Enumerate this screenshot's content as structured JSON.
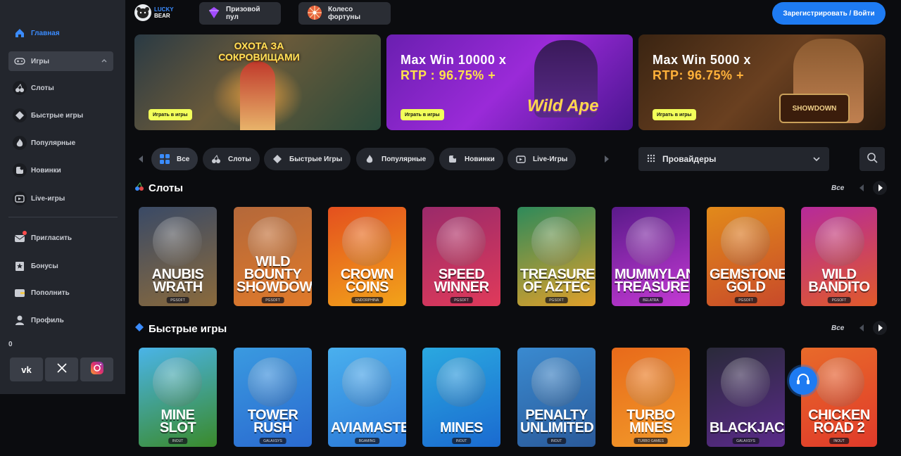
{
  "sidebar": {
    "items": [
      {
        "label": "Главная"
      },
      {
        "label": "Игры"
      },
      {
        "label": "Слоты"
      },
      {
        "label": "Быстрые игры"
      },
      {
        "label": "Популярные"
      },
      {
        "label": "Новинки"
      },
      {
        "label": "Live-игры"
      },
      {
        "label": "Пригласить"
      },
      {
        "label": "Бонусы"
      },
      {
        "label": "Пополнить"
      },
      {
        "label": "Профиль"
      }
    ],
    "balance": "0",
    "socials": [
      "vk-icon",
      "x-icon",
      "instagram-icon"
    ]
  },
  "header": {
    "logo_top": "LUCKY",
    "logo_bottom": "BEAR",
    "prize_pool": "Призовой пул",
    "wheel": "Колесо фортуны",
    "register": "Зарегистрировать / Войти"
  },
  "banners": [
    {
      "title": "ОХОТА ЗА СОКРОВИЩАМИ",
      "cta": "Играть в игры"
    },
    {
      "line1": "Max Win 10000 x",
      "line2": "RTP : 96.75% +",
      "logo": "Wild Ape",
      "cta": "Играть в игры"
    },
    {
      "line1": "Max Win 5000 x",
      "line2": "RTP: 96.75% +",
      "logo": "SHOWDOWN",
      "cta": "Играть в игры"
    }
  ],
  "filters": {
    "chips": [
      {
        "label": "Все"
      },
      {
        "label": "Слоты"
      },
      {
        "label": "Быстрые Игры"
      },
      {
        "label": "Популярные"
      },
      {
        "label": "Новинки"
      },
      {
        "label": "Live-Игры"
      }
    ],
    "providers": "Провайдеры"
  },
  "sections": [
    {
      "title": "Слоты",
      "all": "Все",
      "games": [
        {
          "name": "ANUBIS WRATH",
          "provider": "PGSOFT",
          "c1": "#3a4a66",
          "c2": "#8a6a3c"
        },
        {
          "name": "WILD BOUNTY SHOWDOWN",
          "provider": "PGSOFT",
          "c1": "#b4683a",
          "c2": "#e07a2a"
        },
        {
          "name": "CROWN COINS",
          "provider": "ENDORPHINA",
          "c1": "#e4501e",
          "c2": "#f2a31a"
        },
        {
          "name": "SPEED WINNER",
          "provider": "PGSOFT",
          "c1": "#9a2a6a",
          "c2": "#e03a5a"
        },
        {
          "name": "TREASURES OF AZTEC",
          "provider": "PGSOFT",
          "c1": "#2e8a5a",
          "c2": "#e0a02a"
        },
        {
          "name": "MUMMYLAND TREASURES",
          "provider": "BELATRA",
          "c1": "#5a1a8a",
          "c2": "#c43ad4"
        },
        {
          "name": "GEMSTONES GOLD",
          "provider": "PGSOFT",
          "c1": "#e28a1a",
          "c2": "#c84a2a"
        },
        {
          "name": "WILD BANDITO",
          "provider": "PGSOFT",
          "c1": "#b62a9a",
          "c2": "#e05a2a"
        }
      ]
    },
    {
      "title": "Быстрые игры",
      "all": "Все",
      "games": [
        {
          "name": "MINE SLOT",
          "provider": "INOUT",
          "c1": "#4ab4e8",
          "c2": "#3a8a2a"
        },
        {
          "name": "TOWER RUSH",
          "provider": "GALAXSYS",
          "c1": "#3a9ae0",
          "c2": "#2a6ad0"
        },
        {
          "name": "AVIAMASTERS",
          "provider": "BGAMING",
          "c1": "#4ab0ee",
          "c2": "#2a78d8"
        },
        {
          "name": "MINES",
          "provider": "INOUT",
          "c1": "#2aa8e0",
          "c2": "#1a6ad0"
        },
        {
          "name": "PENALTY UNLIMITED",
          "provider": "INOUT",
          "c1": "#3a8ad0",
          "c2": "#2a5a9a"
        },
        {
          "name": "TURBO MINES",
          "provider": "TURBO GAMES",
          "c1": "#e86a1a",
          "c2": "#f29a2a"
        },
        {
          "name": "BLACKJACK",
          "provider": "GALAXSYS",
          "c1": "#2a2a3a",
          "c2": "#5a2a8a"
        },
        {
          "name": "CHICKEN ROAD 2",
          "provider": "INOUT",
          "c1": "#e86a2a",
          "c2": "#e03a2a"
        }
      ]
    }
  ]
}
